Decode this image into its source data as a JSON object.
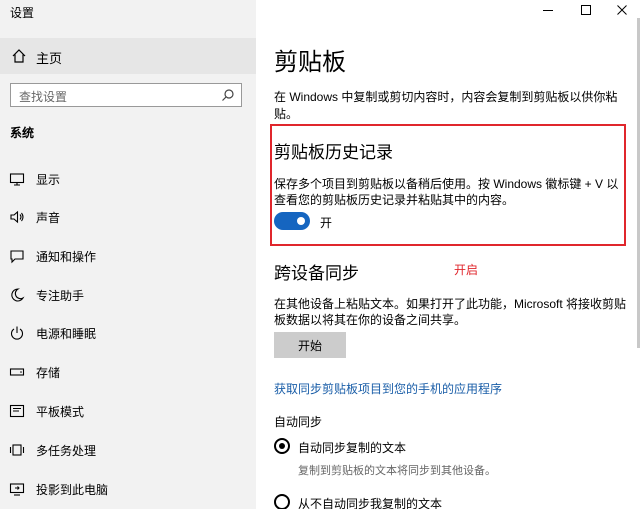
{
  "window": {
    "title": "设置",
    "controls": [
      "minimize-icon",
      "maximize-icon",
      "close-icon"
    ]
  },
  "sidebar": {
    "home_label": "主页",
    "search_placeholder": "查找设置",
    "section_header": "系统",
    "items": [
      {
        "label": "显示",
        "icon": "display-icon"
      },
      {
        "label": "声音",
        "icon": "speaker-icon"
      },
      {
        "label": "通知和操作",
        "icon": "notification-icon"
      },
      {
        "label": "专注助手",
        "icon": "moon-icon"
      },
      {
        "label": "电源和睡眠",
        "icon": "power-icon"
      },
      {
        "label": "存储",
        "icon": "storage-icon"
      },
      {
        "label": "平板模式",
        "icon": "tablet-icon"
      },
      {
        "label": "多任务处理",
        "icon": "multitask-icon"
      },
      {
        "label": "投影到此电脑",
        "icon": "project-icon"
      }
    ]
  },
  "main": {
    "title": "剪贴板",
    "description": "在 Windows 中复制或剪切内容时，内容会复制到剪贴板以供你粘贴。",
    "history": {
      "title": "剪贴板历史记录",
      "description": "保存多个项目到剪贴板以备稍后使用。按 Windows 徽标键 + V 以查看您的剪贴板历史记录并粘贴其中的内容。",
      "toggle_state": "on",
      "toggle_label": "开"
    },
    "annotation": "开启",
    "sync": {
      "title": "跨设备同步",
      "description": "在其他设备上粘贴文本。如果打开了此功能，Microsoft 将接收剪贴板数据以将其在你的设备之间共享。",
      "start_button": "开始",
      "link": "获取同步剪贴板项目到您的手机的应用程序",
      "auto_sync_header": "自动同步",
      "options": [
        {
          "label": "自动同步复制的文本",
          "sub": "复制到剪贴板的文本将同步到其他设备。",
          "selected": true
        },
        {
          "label": "从不自动同步我复制的文本",
          "selected": false
        }
      ]
    }
  },
  "colors": {
    "accent": "#1565c0",
    "highlight_border": "#e0262c",
    "link": "#1a5ea8",
    "sidebar_bg": "#f2f2f2"
  }
}
